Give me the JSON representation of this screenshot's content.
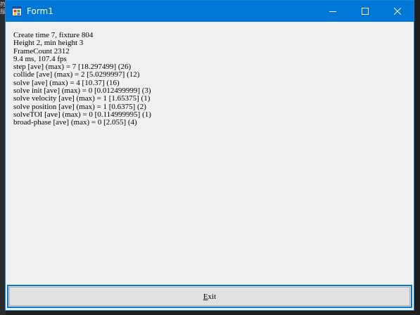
{
  "backdrop": {
    "left_strip_text": "符服"
  },
  "window": {
    "title": "Form1",
    "titlebar_color": "#0078d7",
    "icons": {
      "app": "form-app-icon",
      "minimize": "minimize-icon",
      "maximize": "maximize-icon",
      "close": "close-icon"
    }
  },
  "stats": {
    "lines": [
      "Create time 7, fixture 804",
      "Height 2, min height 3",
      "FrameCount 2312",
      "9.4 ms, 107.4 fps",
      "step [ave] (max) = 7 [18.297499] (26)",
      "collide [ave] (max) = 2 [5.0299997] (12)",
      "solve [ave] (max) = 4 [10.37] (16)",
      "solve init [ave] (max) = 0 [0.012499999] (3)",
      "solve velocity [ave] (max) = 1 [1.65375] (1)",
      "solve position [ave] (max) = 1 [0.6375] (2)",
      "solveTOI [ave] (max) = 0 [0.114999995] (1)",
      "broad-phase [ave] (max) = 0 [2.055] (4)"
    ]
  },
  "exit_button": {
    "label_mnemonic": "E",
    "label_rest": "xit",
    "focus_color": "#0078d7"
  }
}
